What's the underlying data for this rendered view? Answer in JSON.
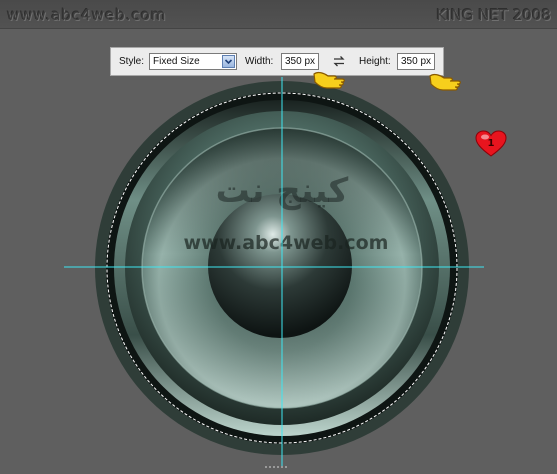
{
  "watermark": {
    "site_url": "www.abc4web.com",
    "brand": "KING NET 2008",
    "arabic_text": "كينج نت",
    "center_url": "www.abc4web.com"
  },
  "options_bar": {
    "style_label": "Style:",
    "style_value": "Fixed Size",
    "width_label": "Width:",
    "width_value": "350 px",
    "height_label": "Height:",
    "height_value": "350 px"
  },
  "icons": {
    "style_dropdown": "chevron-down-icon",
    "swap": "swap-arrows-icon",
    "pointer": "pointing-hand-icon",
    "heart": "heart-icon"
  },
  "colors": {
    "canvas": "#5f5f5f",
    "speaker_rim": "#2f3d38",
    "speaker_metal": "#5d7a72",
    "guide": "#3ee6f0",
    "selection": "#ffffff",
    "heart": "#e8141e"
  },
  "heart_badge": "1"
}
